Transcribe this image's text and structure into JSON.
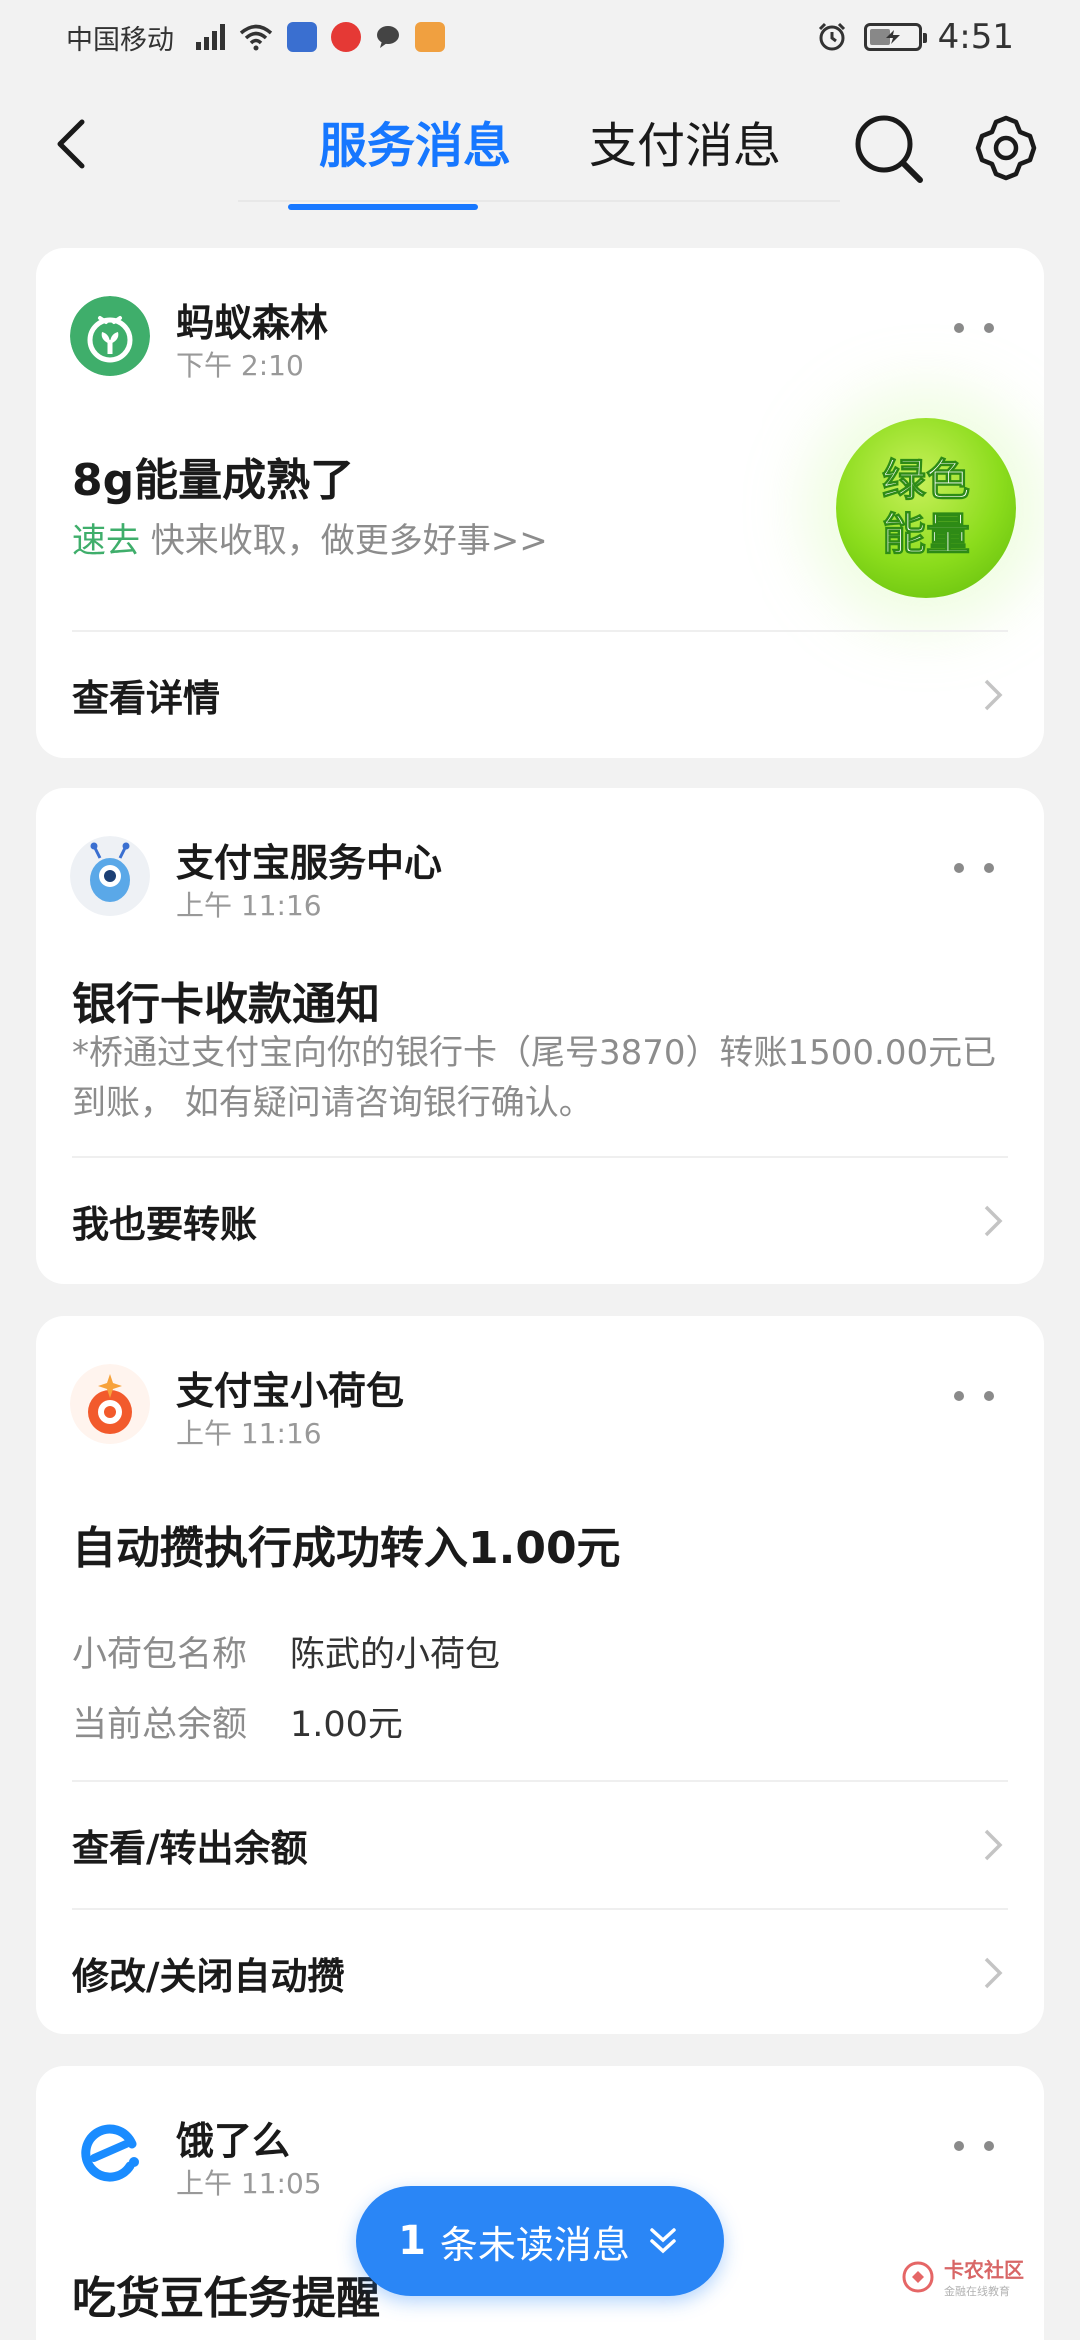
{
  "status_bar": {
    "carrier": "中国移动",
    "time": "4:51",
    "battery_level": 0.45,
    "notification_icons": [
      "signal-icon",
      "wifi-icon",
      "app-notification-icon",
      "app-notification-icon",
      "chat-bubble-icon",
      "app-notification-icon"
    ]
  },
  "nav": {
    "tabs": [
      {
        "label": "服务消息",
        "active": true
      },
      {
        "label": "支付消息",
        "active": false
      }
    ],
    "accent": "#1677ff"
  },
  "cards": [
    {
      "sender": "蚂蚁森林",
      "time": "下午 2:10",
      "title": "8g能量成熟了",
      "highlight": "速去",
      "subtitle": " 快来收取，做更多好事>>",
      "badge": "绿色能量",
      "action": "查看详情"
    },
    {
      "sender": "支付宝服务中心",
      "time": "上午 11:16",
      "title": "银行卡收款通知",
      "body": "*桥通过支付宝向你的银行卡（尾号3870）转账1500.00元已到账， 如有疑问请咨询银行确认。",
      "action": "我也要转账"
    },
    {
      "sender": "支付宝小荷包",
      "time": "上午 11:16",
      "title": "自动攒执行成功转入1.00元",
      "fields": [
        {
          "key": "小荷包名称",
          "value": "陈武的小荷包"
        },
        {
          "key": "当前总余额",
          "value": "1.00元"
        }
      ],
      "actions": [
        "查看/转出余额",
        "修改/关闭自动攒"
      ]
    },
    {
      "sender": "饿了么",
      "time": "上午 11:05",
      "title": "吃货豆任务提醒"
    }
  ],
  "unread": {
    "count": "1",
    "label": "条未读消息"
  },
  "watermark": {
    "name": "卡农社区",
    "sub": "金融在线教育"
  }
}
